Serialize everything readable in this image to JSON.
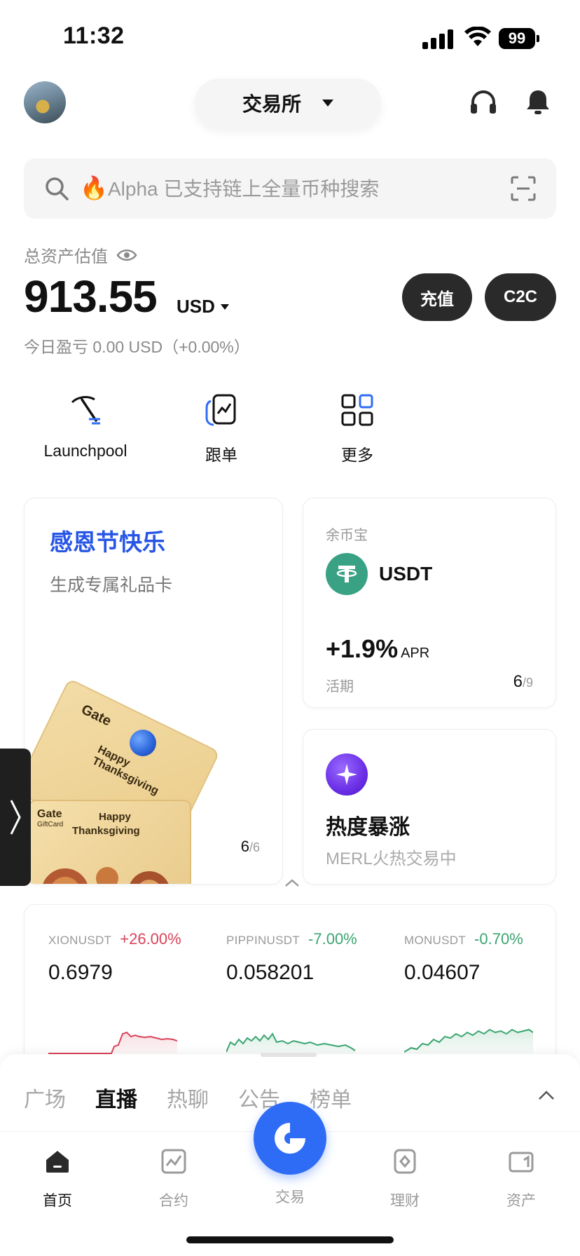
{
  "status_bar": {
    "time": "11:32",
    "battery": "99"
  },
  "header": {
    "exchange_label": "交易所"
  },
  "search": {
    "placeholder": "Alpha 已支持链上全量币种搜索"
  },
  "assets": {
    "label": "总资产估值",
    "balance": "913.55",
    "currency": "USD",
    "pnl": "今日盈亏 0.00 USD（+0.00%）",
    "deposit_label": "充值",
    "c2c_label": "C2C"
  },
  "quick_actions": [
    {
      "label": "Launchpool",
      "icon": "pickaxe-icon"
    },
    {
      "label": "跟单",
      "icon": "copy-trade-icon"
    },
    {
      "label": "更多",
      "icon": "grid-more-icon"
    }
  ],
  "promo_card": {
    "title": "感恩节快乐",
    "subtitle": "生成专属礼品卡",
    "pager_current": "6",
    "pager_total": "/6",
    "giftcard_brand": "Gate",
    "giftcard_sub": "GiftCard",
    "giftcard_text1": "Happy Thanksgiving",
    "giftcard_text2a": "Happy",
    "giftcard_text2b": "Thanksgiving"
  },
  "earn_card": {
    "label": "余币宝",
    "coin": "USDT",
    "apr_value": "+1.9%",
    "apr_unit": "APR",
    "term": "活期",
    "pager_current": "6",
    "pager_total": "/9"
  },
  "hot_card": {
    "title": "热度暴涨",
    "subtitle": "MERL火热交易中"
  },
  "tickers": [
    {
      "symbol": "XIONUSDT",
      "change": "+26.00%",
      "price": "0.6979",
      "direction": "up"
    },
    {
      "symbol": "PIPPINUSDT",
      "change": "-7.00%",
      "price": "0.058201",
      "direction": "down"
    },
    {
      "symbol": "MONUSDT",
      "change": "-0.70%",
      "price": "0.04607",
      "direction": "down"
    }
  ],
  "feed_tabs": [
    {
      "label": "广场",
      "active": false
    },
    {
      "label": "直播",
      "active": true
    },
    {
      "label": "热聊",
      "active": false
    },
    {
      "label": "公告",
      "active": false
    },
    {
      "label": "榜单",
      "active": false
    }
  ],
  "bottom_nav": [
    {
      "label": "首页",
      "active": true
    },
    {
      "label": "合约",
      "active": false
    },
    {
      "label": "交易",
      "active": false
    },
    {
      "label": "理财",
      "active": false
    },
    {
      "label": "资产",
      "active": false
    }
  ],
  "colors": {
    "accent": "#2f6cf6",
    "up": "#d9435a",
    "down": "#3aa56f",
    "promo_title": "#2756e6"
  }
}
